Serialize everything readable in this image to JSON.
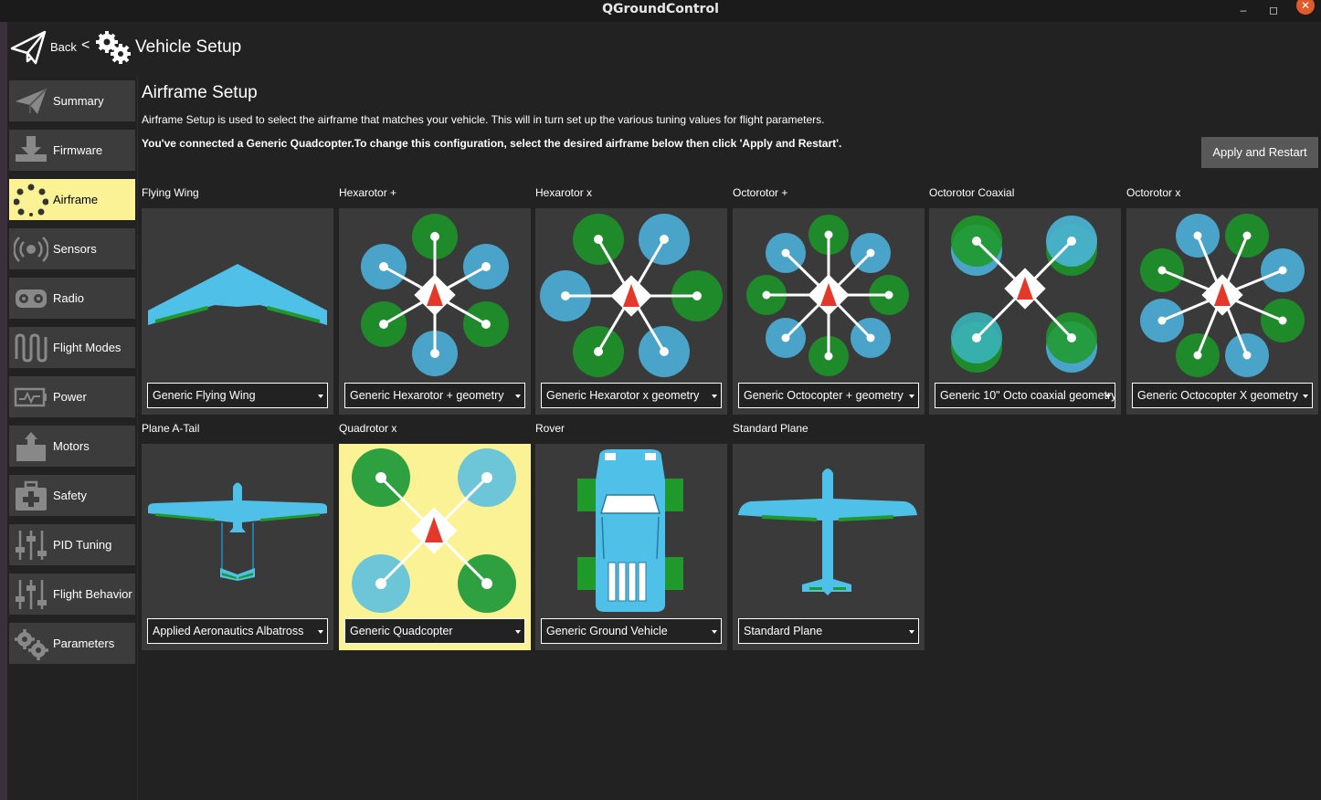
{
  "window": {
    "title": "QGroundControl",
    "minimize": "–",
    "maximize": "◻",
    "close": "✕"
  },
  "toolbar": {
    "back_label": "Back",
    "separator": "<",
    "section_title": "Vehicle Setup"
  },
  "sidebar": {
    "items": [
      {
        "label": "Summary",
        "icon": "paper-plane-icon"
      },
      {
        "label": "Firmware",
        "icon": "download-icon"
      },
      {
        "label": "Airframe",
        "icon": "airframe-dots-icon",
        "active": true
      },
      {
        "label": "Sensors",
        "icon": "sensors-icon"
      },
      {
        "label": "Radio",
        "icon": "radio-icon"
      },
      {
        "label": "Flight Modes",
        "icon": "flight-modes-icon"
      },
      {
        "label": "Power",
        "icon": "power-icon"
      },
      {
        "label": "Motors",
        "icon": "motors-icon"
      },
      {
        "label": "Safety",
        "icon": "safety-icon"
      },
      {
        "label": "PID Tuning",
        "icon": "sliders-icon"
      },
      {
        "label": "Flight Behavior",
        "icon": "sliders-icon"
      },
      {
        "label": "Parameters",
        "icon": "gears-icon"
      }
    ]
  },
  "main": {
    "title": "Airframe Setup",
    "description": "Airframe Setup is used to select the airframe that matches your vehicle. This will in turn set up the various tuning values for flight parameters.",
    "connected_text": "You've connected a Generic Quadcopter.To change this configuration, select the desired airframe below then click 'Apply and Restart'.",
    "apply_button": "Apply and Restart"
  },
  "airframes": [
    {
      "name": "Flying Wing",
      "selected_option": "Generic Flying Wing"
    },
    {
      "name": "Hexarotor +",
      "selected_option": "Generic Hexarotor + geometry"
    },
    {
      "name": "Hexarotor x",
      "selected_option": "Generic Hexarotor x geometry"
    },
    {
      "name": "Octorotor +",
      "selected_option": "Generic Octocopter + geometry"
    },
    {
      "name": "Octorotor Coaxial",
      "selected_option": "Generic 10\" Octo coaxial geometry"
    },
    {
      "name": "Octorotor x",
      "selected_option": "Generic Octocopter X geometry"
    },
    {
      "name": "Plane A-Tail",
      "selected_option": "Applied Aeronautics Albatross"
    },
    {
      "name": "Quadrotor x",
      "selected_option": "Generic Quadcopter",
      "selected": true
    },
    {
      "name": "Rover",
      "selected_option": "Generic Ground Vehicle"
    },
    {
      "name": "Standard Plane",
      "selected_option": "Standard Plane"
    }
  ],
  "colors": {
    "active": "#fbf295",
    "rotor_blue": "#4aa3c8",
    "rotor_green": "#1f8a2a",
    "airframe_blue": "#4fc0e8",
    "arrow_red": "#e4392a"
  }
}
